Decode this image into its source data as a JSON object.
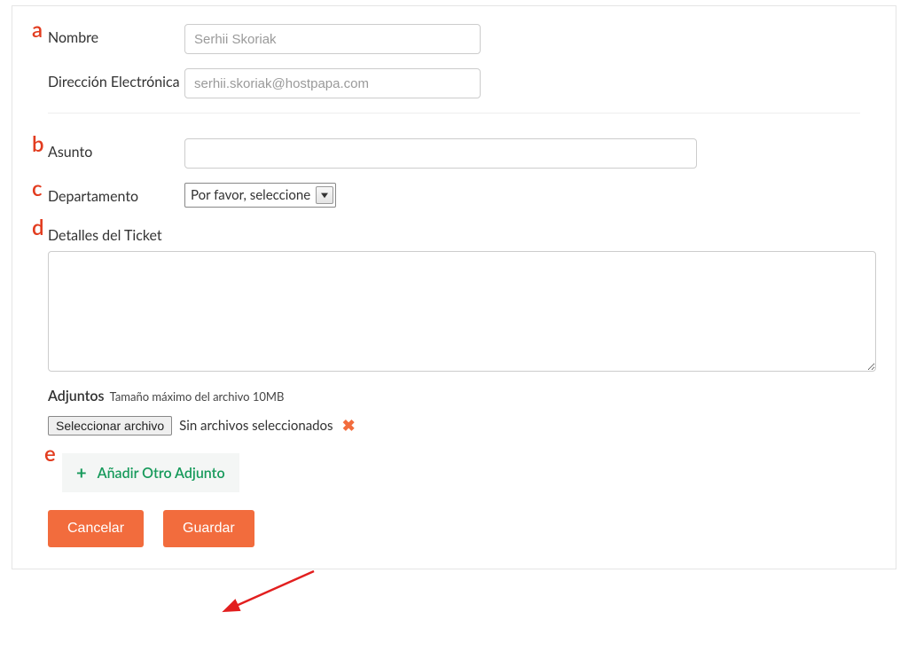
{
  "markers": {
    "a": "a",
    "b": "b",
    "c": "c",
    "d": "d",
    "e": "e"
  },
  "fields": {
    "name": {
      "label": "Nombre",
      "value": "Serhii Skoriak"
    },
    "email": {
      "label": "Dirección Electrónica",
      "value": "serhii.skoriak@hostpapa.com"
    },
    "subject": {
      "label": "Asunto",
      "value": ""
    },
    "department": {
      "label": "Departamento",
      "selected": "Por favor, seleccione"
    },
    "details": {
      "label": "Detalles del Ticket",
      "value": ""
    }
  },
  "attachments": {
    "title": "Adjuntos",
    "subtitle": "Tamaño máximo del archivo 10MB",
    "select_file": "Seleccionar archivo",
    "no_file": "Sin archivos seleccionados",
    "add_another": "Añadir Otro Adjunto"
  },
  "buttons": {
    "cancel": "Cancelar",
    "save": "Guardar"
  }
}
